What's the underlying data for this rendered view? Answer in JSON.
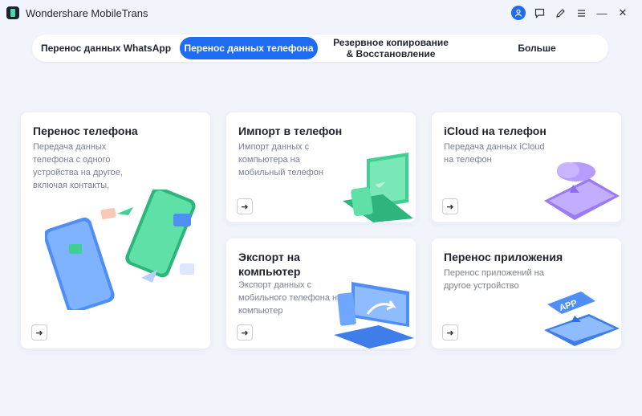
{
  "app": {
    "title": "Wondershare MobileTrans"
  },
  "window_controls": {
    "user": "user-icon",
    "feedback": "message-icon",
    "edit": "edit-icon",
    "menu": "menu-icon",
    "minimize": "—",
    "close": "✕"
  },
  "tabs": [
    {
      "label": "Перенос данных WhatsApp",
      "active": false
    },
    {
      "label": "Перенос данных телефона",
      "active": true
    },
    {
      "label": "Резервное копирование & Восстановление",
      "active": false
    },
    {
      "label": "Больше",
      "active": false
    }
  ],
  "cards": {
    "phone_transfer": {
      "title": "Перенос телефона",
      "desc": "Передача данных телефона с одного устройства на другое, включая контакты,"
    },
    "import": {
      "title": "Импорт в телефон",
      "desc": "Импорт данных с компьютера на мобильный телефон"
    },
    "icloud": {
      "title": "iCloud на телефон",
      "desc": "Передача данных iCloud на телефон"
    },
    "export": {
      "title": "Экспорт на компьютер",
      "desc": "Экспорт данных с мобильного телефона на компьютер"
    },
    "app_transfer": {
      "title": "Перенос приложения",
      "desc": "Перенос приложений на другое устройство",
      "badge": "APP"
    }
  },
  "colors": {
    "accent": "#1e6cf1",
    "green": "#3fcf93",
    "purple": "#9b7bf0",
    "blue": "#4f8ef5"
  }
}
